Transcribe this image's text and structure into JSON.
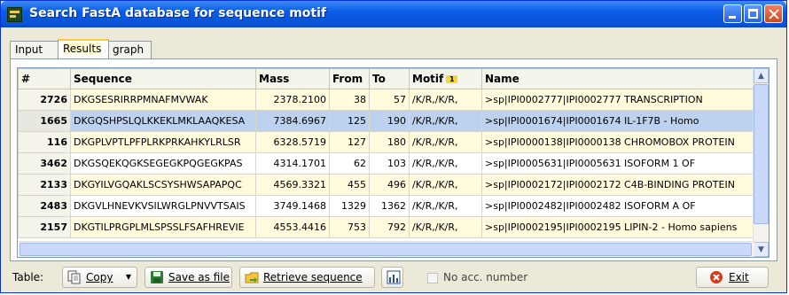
{
  "window": {
    "title": "Search FastA database for sequence motif"
  },
  "tabs": [
    {
      "label": "Input"
    },
    {
      "label": "Results"
    },
    {
      "label": "graph"
    }
  ],
  "table": {
    "headers": [
      "#",
      "Sequence",
      "Mass",
      "From",
      "To",
      "Motif",
      "Name"
    ],
    "motif_sort_badge": "1",
    "rows": [
      {
        "id": "2726",
        "sequence": "DKGSESRIRRPMNAFMVWAK",
        "mass": "2378.2100",
        "from": "38",
        "to": "57",
        "motif": "/K/R,/K/R,",
        "name": ">sp|IPI0002777|IPI0002777  TRANSCRIPTION"
      },
      {
        "id": "1665",
        "sequence": "DKGQSHPSLQLKKEKLMKLAAQKESA",
        "mass": "7384.6967",
        "from": "125",
        "to": "190",
        "motif": "/K/R,/K/R,",
        "name": ">sp|IPI0001674|IPI0001674  IL-1F7B - Homo"
      },
      {
        "id": "116",
        "sequence": "DKGPLVPTLPFPLRKPRKAHKYLRLSR",
        "mass": "6328.5719",
        "from": "127",
        "to": "180",
        "motif": "/K/R,/K/R,",
        "name": ">sp|IPI0000138|IPI0000138  CHROMOBOX PROTEIN"
      },
      {
        "id": "3462",
        "sequence": "DKGSQEKQGKSEGEGKPQGEGKPAS",
        "mass": "4314.1701",
        "from": "62",
        "to": "103",
        "motif": "/K/R,/K/R,",
        "name": ">sp|IPI0005631|IPI0005631  ISOFORM 1 OF"
      },
      {
        "id": "2133",
        "sequence": "DKGYILVGQAKLSCSYSHWSAPAPQC",
        "mass": "4569.3321",
        "from": "455",
        "to": "496",
        "motif": "/K/R,/K/R,",
        "name": ">sp|IPI0002172|IPI0002172  C4B-BINDING PROTEIN"
      },
      {
        "id": "2483",
        "sequence": "DKGVLHNEVKVSILWRGLPNVVTSAIS",
        "mass": "3749.1468",
        "from": "1329",
        "to": "1362",
        "motif": "/K/R,/K/R,",
        "name": ">sp|IPI0002482|IPI0002482  ISOFORM A OF"
      },
      {
        "id": "2157",
        "sequence": "DKGTILPRGPLMLSPSSLFSAFHREVIE",
        "mass": "4553.4416",
        "from": "753",
        "to": "792",
        "motif": "/K/R,/K/R,",
        "name": ">sp|IPI0002195|IPI0002195  LIPIN-2 - Homo sapiens"
      }
    ]
  },
  "toolbar": {
    "table_label": "Table:",
    "copy": "Copy",
    "save": "Save as file",
    "retrieve": "Retrieve sequence",
    "no_acc": "No acc. number",
    "exit": "Exit"
  }
}
